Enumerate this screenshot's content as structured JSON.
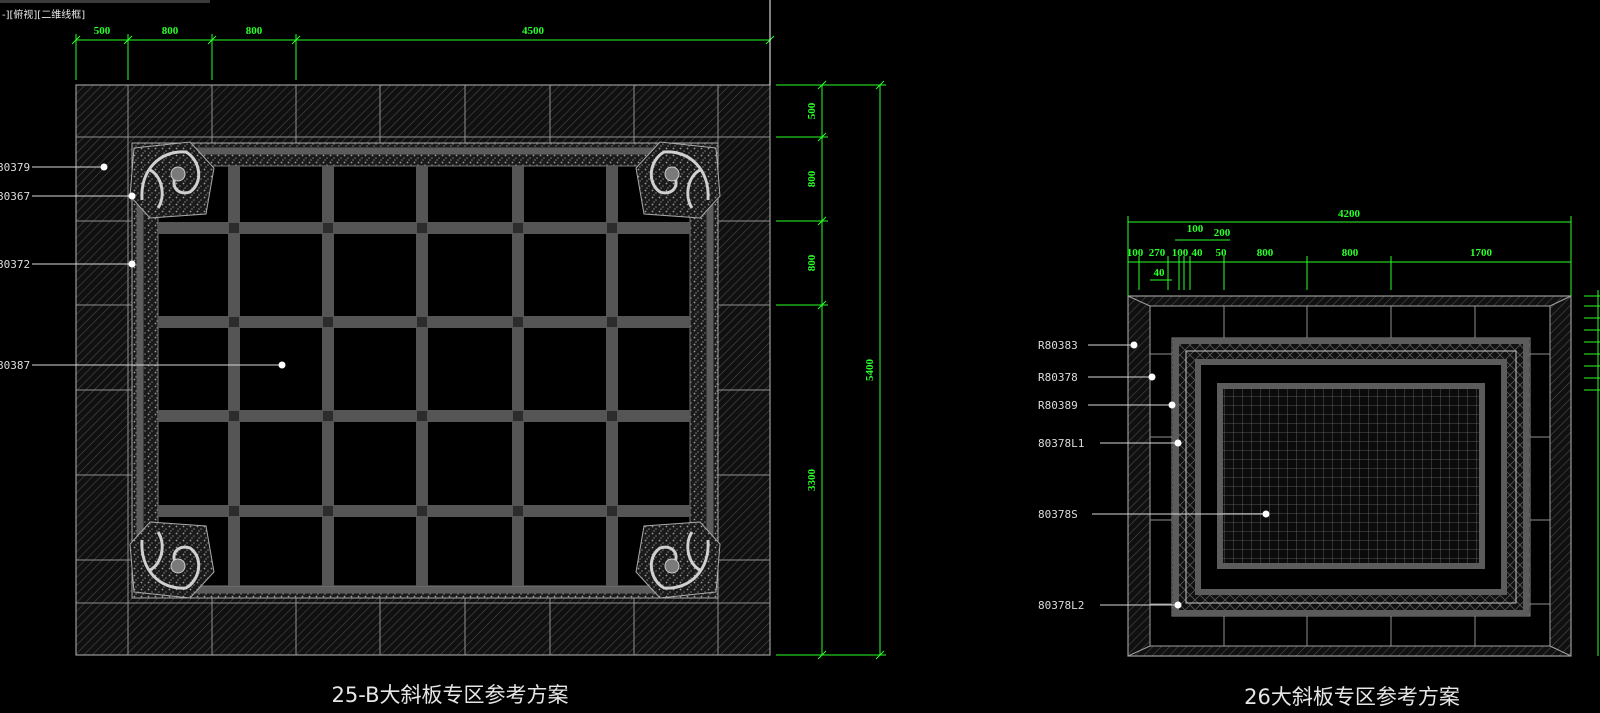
{
  "view_label": "-][俯视][二维线框]",
  "drawing_left": {
    "title": "25-B大斜板专区参考方案",
    "dims_top": [
      "500",
      "800",
      "800",
      "4500"
    ],
    "dims_right": [
      "500",
      "800",
      "800",
      "3300",
      "5400"
    ],
    "callouts": [
      "80379",
      "80367",
      "80372",
      "80387"
    ]
  },
  "drawing_right": {
    "title": "26大斜板专区参考方案",
    "dims_top": [
      "4200",
      "100",
      "200",
      "100",
      "270",
      "100",
      "40",
      "50",
      "800",
      "800",
      "1700",
      "40"
    ],
    "callouts": [
      "R80383",
      "R80378",
      "R80389",
      "80378L1",
      "80378S",
      "80378L2"
    ]
  },
  "colors": {
    "background": "#000000",
    "dimension": "#29ff29",
    "linework": "#8f8f8f",
    "band": "#555555",
    "text": "#e6e6e6"
  }
}
